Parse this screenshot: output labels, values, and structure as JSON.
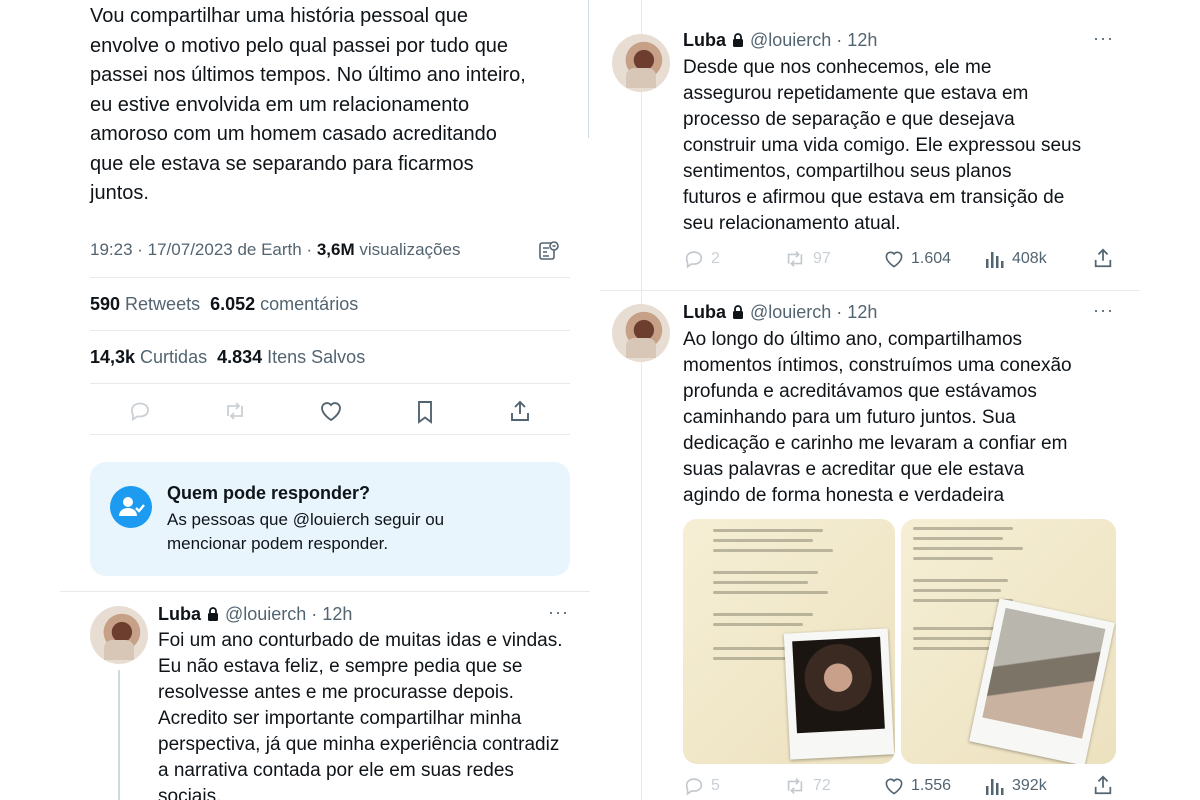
{
  "main_tweet": {
    "text_lines": [
      "Vou compartilhar uma história pessoal que",
      "envolve o motivo pelo qual passei por tudo que",
      "passei nos últimos tempos. No último ano inteiro,",
      "eu estive envolvida em um relacionamento",
      "amoroso com um homem casado acreditando",
      "que ele estava se separando para ficarmos",
      "juntos."
    ],
    "timestamp": "19:23 · 17/07/2023 de Earth · ",
    "views_count": "3,6M",
    "views_label": " visualizações",
    "retweets_count": "590",
    "retweets_label": " Retweets",
    "comments_count": "6.052",
    "comments_label": " comentários",
    "likes_count": "14,3k",
    "likes_label": " Curtidas",
    "saves_count": "4.834",
    "saves_label": " Itens Salvos"
  },
  "reply_restriction": {
    "title": "Quem pode responder?",
    "desc_line1": "As pessoas que @louierch seguir ou",
    "desc_line2": "mencionar podem responder."
  },
  "thread": [
    {
      "name": "Luba",
      "handle": "@louierch · 12h",
      "text_lines": [
        "Foi um ano conturbado de muitas idas e vindas.",
        "Eu não estava feliz, e sempre pedia que se",
        "resolvesse antes e me procurasse depois.",
        "Acredito ser importante compartilhar minha",
        "perspectiva, já que minha experiência contradiz",
        "a narrativa contada por ele em suas redes",
        "sociais."
      ]
    },
    {
      "name": "Luba",
      "handle": "@louierch · 12h",
      "text_lines": [
        "Desde que nos conhecemos, ele me",
        "assegurou repetidamente que estava em",
        "processo de separação e que desejava",
        "construir uma vida comigo. Ele expressou seus",
        "sentimentos, compartilhou seus planos",
        "futuros e afirmou que estava em transição de",
        "seu relacionamento atual."
      ],
      "replies": "2",
      "retweets": "97",
      "likes": "1.604",
      "views": "408k"
    },
    {
      "name": "Luba",
      "handle": "@louierch · 12h",
      "text_lines": [
        "Ao longo do último ano, compartilhamos",
        "momentos íntimos, construímos uma conexão",
        "profunda e acreditávamos que estávamos",
        "caminhando para um futuro juntos. Sua",
        "dedicação e carinho me levaram a confiar em",
        "suas palavras e acreditar que ele estava",
        "agindo de forma honesta e verdadeira"
      ],
      "replies": "5",
      "retweets": "72",
      "likes": "1.556",
      "views": "392k"
    }
  ],
  "icons": {
    "reply": "reply-icon",
    "retweet": "retweet-icon",
    "like": "heart-icon",
    "bookmark": "bookmark-icon",
    "share": "share-icon",
    "views": "analytics-icon",
    "lock": "lock-icon",
    "more": "more-icon",
    "people": "people-icon"
  },
  "colors": {
    "text": "#0f1419",
    "muted": "#536471",
    "accent": "#1d9bf0",
    "reply_box_bg": "#e8f5fd",
    "divider": "#e7e9ea"
  }
}
